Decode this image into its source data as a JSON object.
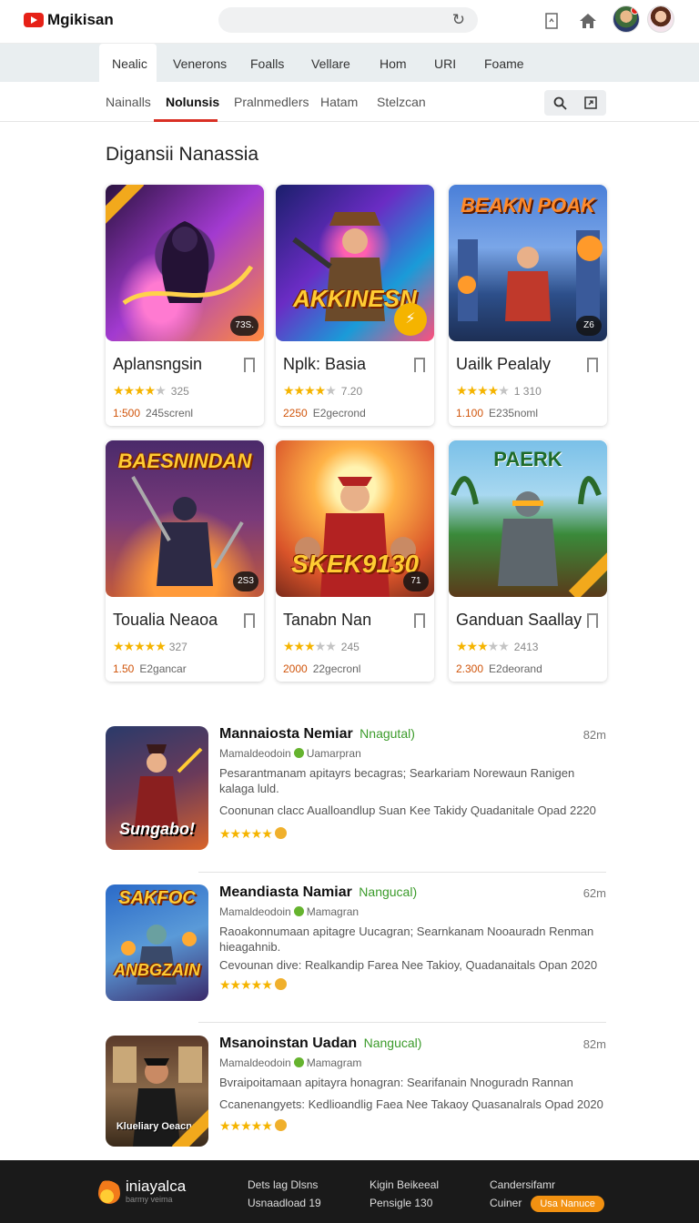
{
  "header": {
    "logo_text": "Mgikisan"
  },
  "category_tabs": [
    "Nealic",
    "Venerons",
    "Foalls",
    "Vellare",
    "Hom",
    "URI",
    "Foame"
  ],
  "sub_tabs": [
    "Nainalls",
    "Nolunsis",
    "Pralnmedlers",
    "Hatam",
    "Stelzcan"
  ],
  "section": {
    "title": "Digansii Nanassia"
  },
  "cards": [
    {
      "title": "Aplansngsin",
      "rating_num": "325",
      "price": "1:500",
      "meta": "245screnl",
      "badge": "73S.",
      "stars": 3.5,
      "art": "violet"
    },
    {
      "title": "Nplk: Basia",
      "rating_num": "7.20",
      "price": "2250",
      "meta": "E2gecrond",
      "badge": "",
      "overlay": "AKKINESN",
      "stars": 4,
      "art": "neon"
    },
    {
      "title": "Uailk Pealaly",
      "rating_num": "1 310",
      "price": "1.100",
      "meta": "E235noml",
      "badge": "Z6",
      "overlay": "BEAKN POAK",
      "stars": 3.5,
      "art": "city"
    },
    {
      "title": "Toualia Neaoa",
      "rating_num": "327",
      "price": "1.50",
      "meta": "E2gancar",
      "badge": "2S3",
      "overlay": "BAESNINDAN",
      "stars": 4.5,
      "art": "dusk"
    },
    {
      "title": "Tanabn Nan",
      "rating_num": "245",
      "price": "2000",
      "meta": "22gecronl",
      "badge": "71",
      "overlay": "SKEK9130",
      "stars": 3.5,
      "art": "crowd"
    },
    {
      "title": "Ganduan Saallay",
      "rating_num": "2413",
      "price": "2.300",
      "meta": "E2deorand",
      "badge": "",
      "overlay": "PAERK",
      "stars": 3.5,
      "art": "jungle"
    }
  ],
  "list_items": [
    {
      "title": "Mannaiosta Nemiar",
      "tag": "Nnagutal)",
      "time": "82m",
      "sub1": "Mamaldeodoin",
      "sub2": "Uamarpran",
      "desc": "Pesarantmanam apitayrs becagras; Searkariam Norewaun Ranigen kalaga luld.",
      "extra": "Coonunan clacc Aualloandlup Suan Kee Takidy Quadanitale Opad 2220",
      "overlay": "Sungabo!",
      "art": "red"
    },
    {
      "title": "Meandiasta Namiar",
      "tag": "Nangucal)",
      "time": "62m",
      "sub1": "Mamaldeodoin",
      "sub2": "Mamagran",
      "desc": "Raoakonnumaan apitagre Uucagran; Searnkanam Nooauradn Renman hieagahnib.",
      "extra": "Cevounan dive: Realkandip Farea Nee Takioy, Quadanaitals Opan 2020",
      "overlay": "SAKFOC",
      "overlay2": "ANBGZAIN",
      "art": "blue"
    },
    {
      "title": "Msanoinstan Uadan",
      "tag": "Nangucal)",
      "time": "82m",
      "sub1": "Mamaldeodoin",
      "sub2": "Mamagram",
      "desc": "Bvraipoitamaan apitayra honagran: Searifanain Nnoguradn Rannan",
      "extra": "Ccanenangyets: Kedlioandlig Faea Nee Takaoy Quasanalrals Opad 2020",
      "overlay": "Klueliary Oeacne",
      "art": "room"
    }
  ],
  "footer": {
    "brand": "iniayalca",
    "tagline": "barmy veima",
    "col1": [
      "Dets lag Dlsns",
      "Usnaadload 19"
    ],
    "col2": [
      "Kigin Beikeeal",
      "Pensigle 130"
    ],
    "col3_top": "Candersifamr",
    "col3_label": "Cuiner",
    "col3_button": "Usa Nanuce"
  },
  "colors": {
    "brand_red": "#e62117",
    "tab_underline": "#d93025",
    "star": "#f5b400",
    "tag_green": "#3b9b2a",
    "footer_bg": "#1a1a1a",
    "footer_button": "#f29111"
  }
}
